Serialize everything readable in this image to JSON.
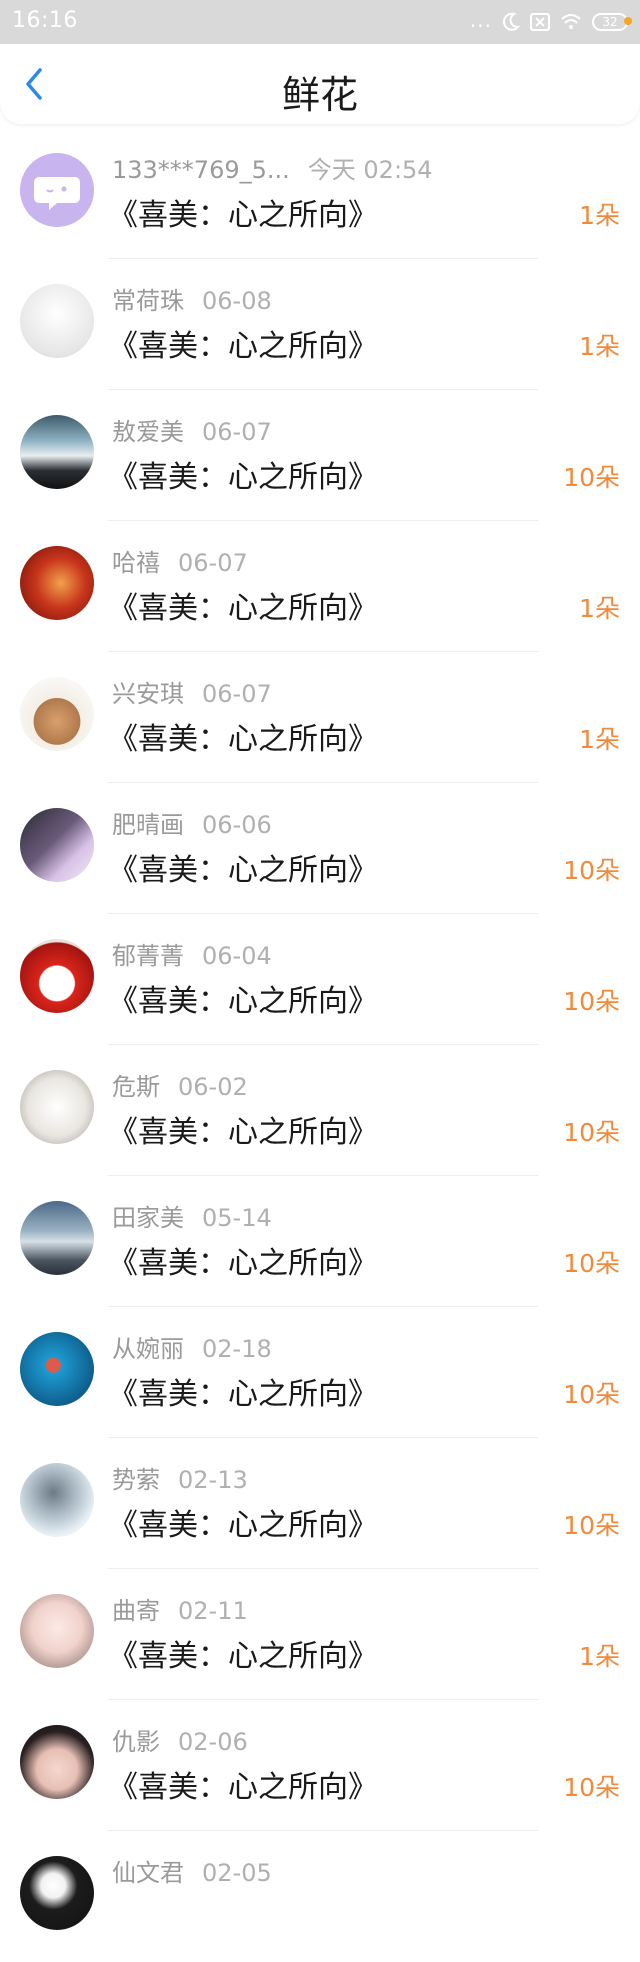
{
  "status_bar": {
    "time": "16:16",
    "dots": "...",
    "battery": "32"
  },
  "header": {
    "title": "鲜花"
  },
  "colors": {
    "accent_blue": "#2a8ae8",
    "count_orange": "#f08a3c",
    "status_bar_bg": "#d9d9d9"
  },
  "items": [
    {
      "name": "133***769_5...",
      "date": "今天 02:54",
      "book": "《喜美：心之所向》",
      "count": "1朵",
      "avatar": "chat-bubble-avatar"
    },
    {
      "name": "常荷珠",
      "date": "06-08",
      "book": "《喜美：心之所向》",
      "count": "1朵",
      "avatar": "branch-vase-avatar"
    },
    {
      "name": "敖爱美",
      "date": "06-07",
      "book": "《喜美：心之所向》",
      "count": "10朵",
      "avatar": "seascape-avatar"
    },
    {
      "name": "哈禧",
      "date": "06-07",
      "book": "《喜美：心之所向》",
      "count": "1朵",
      "avatar": "red-horse-avatar"
    },
    {
      "name": "兴安琪",
      "date": "06-07",
      "book": "《喜美：心之所向》",
      "count": "1朵",
      "avatar": "top-hat-figure-avatar"
    },
    {
      "name": "肥晴画",
      "date": "06-06",
      "book": "《喜美：心之所向》",
      "count": "10朵",
      "avatar": "portrait-avatar"
    },
    {
      "name": "郁菁菁",
      "date": "06-04",
      "book": "《喜美：心之所向》",
      "count": "10朵",
      "avatar": "red-hood-cat-avatar"
    },
    {
      "name": "危斯",
      "date": "06-02",
      "book": "《喜美：心之所向》",
      "count": "10朵",
      "avatar": "white-cat-avatar"
    },
    {
      "name": "田家美",
      "date": "05-14",
      "book": "《喜美：心之所向》",
      "count": "10朵",
      "avatar": "misty-landscape-avatar"
    },
    {
      "name": "从婉丽",
      "date": "02-18",
      "book": "《喜美：心之所向》",
      "count": "10朵",
      "avatar": "blue-illustration-avatar"
    },
    {
      "name": "势萦",
      "date": "02-13",
      "book": "《喜美：心之所向》",
      "count": "10朵",
      "avatar": "snow-figure-avatar"
    },
    {
      "name": "曲寄",
      "date": "02-11",
      "book": "《喜美：心之所向》",
      "count": "1朵",
      "avatar": "pale-face-avatar"
    },
    {
      "name": "仇影",
      "date": "02-06",
      "book": "《喜美：心之所向》",
      "count": "10朵",
      "avatar": "red-lips-avatar"
    },
    {
      "name": "仙文君",
      "date": "02-05",
      "book": "",
      "count": "",
      "avatar": "dark-avatar"
    }
  ]
}
